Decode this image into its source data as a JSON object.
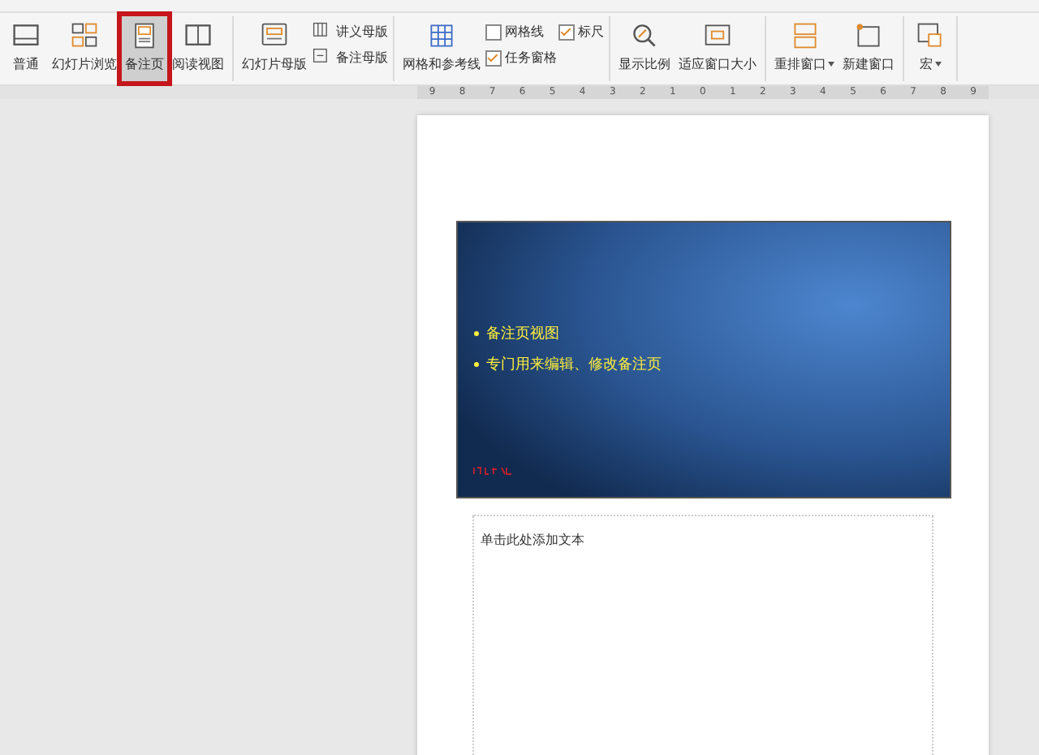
{
  "ribbon": {
    "groups": [
      {
        "items": [
          {
            "kind": "large",
            "label": "普通",
            "selected": false
          },
          {
            "kind": "large",
            "label": "幻灯片浏览",
            "selected": false
          },
          {
            "kind": "large",
            "label": "备注页",
            "selected": true,
            "highlighted": true
          },
          {
            "kind": "large",
            "label": "阅读视图",
            "selected": false
          }
        ]
      },
      {
        "items": [
          {
            "kind": "large",
            "label": "幻灯片母版",
            "selected": false
          },
          {
            "kind": "stack",
            "rows": [
              {
                "kind": "small",
                "label": "讲义母版"
              },
              {
                "kind": "small",
                "label": "备注母版"
              }
            ]
          }
        ]
      },
      {
        "items": [
          {
            "kind": "large",
            "label": "网格和参考线",
            "selected": false
          },
          {
            "kind": "stack",
            "rows": [
              {
                "kind": "check",
                "label": "网格线",
                "checked": false
              },
              {
                "kind": "check",
                "label": "任务窗格",
                "checked": true
              }
            ]
          },
          {
            "kind": "stack",
            "rows": [
              {
                "kind": "check",
                "label": "标尺",
                "checked": true
              }
            ]
          }
        ]
      },
      {
        "items": [
          {
            "kind": "large",
            "label": "显示比例",
            "selected": false
          },
          {
            "kind": "large",
            "label": "适应窗口大小",
            "selected": false
          }
        ]
      },
      {
        "items": [
          {
            "kind": "large",
            "label": "重排窗口",
            "selected": false,
            "dropdown": true
          },
          {
            "kind": "large",
            "label": "新建窗口",
            "selected": false
          }
        ]
      },
      {
        "items": [
          {
            "kind": "large",
            "label": "宏",
            "selected": false,
            "dropdown": true
          }
        ]
      }
    ]
  },
  "ruler_marks": [
    "9",
    "8",
    "7",
    "6",
    "5",
    "4",
    "3",
    "2",
    "1",
    "0",
    "1",
    "2",
    "3",
    "4",
    "5",
    "6",
    "7",
    "8",
    "9"
  ],
  "slide": {
    "bullets": [
      "备注页视图",
      "专门用来编辑、修改备注页"
    ]
  },
  "notes": {
    "placeholder": "单击此处添加文本"
  }
}
